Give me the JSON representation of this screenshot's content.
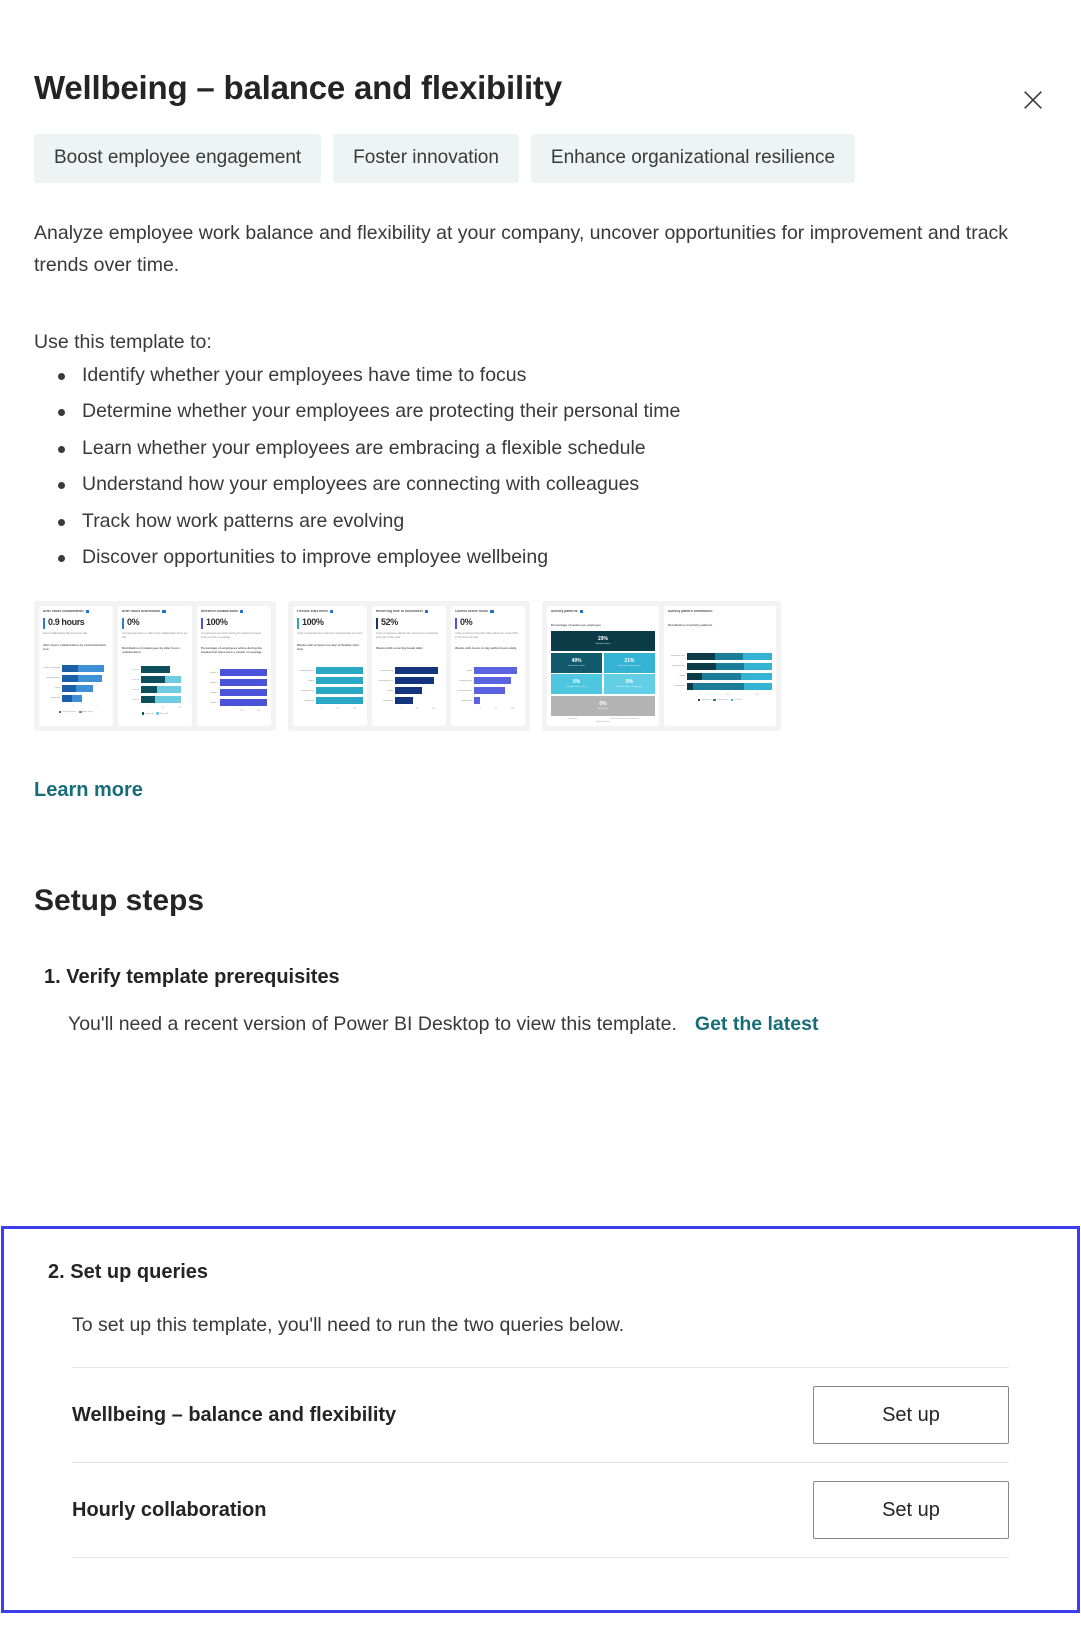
{
  "close_icon": "close-icon",
  "header": {
    "title": "Wellbeing – balance and flexibility",
    "chips": [
      "Boost employee engagement",
      "Foster innovation",
      "Enhance organizational resilience"
    ]
  },
  "intro": "Analyze employee work balance and flexibility at your company, uncover opportunities for improvement and track trends over time.",
  "uses_label": "Use this template to:",
  "uses": [
    "Identify whether your employees have time to focus",
    "Determine whether your employees are protecting their personal time",
    "Learn whether your employees are embracing a flexible schedule",
    "Understand how your employees are connecting with colleagues",
    "Track how work patterns are evolving",
    "Discover opportunities to improve employee wellbeing"
  ],
  "learn_more": "Learn more",
  "setup": {
    "heading": "Setup steps",
    "step1": {
      "heading": "1. Verify template prerequisites",
      "body": "You'll need a recent version of Power BI Desktop to view this template.",
      "link": "Get the latest"
    },
    "step2": {
      "heading": "2. Set up queries",
      "body": "To set up this template, you'll need to run the two queries below.",
      "queries": [
        {
          "name": "Wellbeing – balance and flexibility",
          "button": "Set up"
        },
        {
          "name": "Hourly collaboration",
          "button": "Set up"
        }
      ]
    }
  },
  "colors": {
    "accent_link": "#176e7a",
    "focus_border": "#3d3df0",
    "chip_bg": "#eef4f4",
    "blue": "#2b7cd3",
    "teal_dark": "#0d4e5c",
    "cyan": "#35b3d4",
    "indigo": "#4a53d8",
    "navy": "#1b3f8f",
    "gray": "#b3b3b3"
  },
  "chart_data": [
    {
      "type": "bar",
      "title": "After hours collaboration",
      "kpi": "0.9 hours",
      "kpi_sub": "spent collaborating after hours per day",
      "section": "After hours collaboration by communication tool",
      "categories": [
        "Instant Messages",
        "Email Hours",
        "Calls",
        "Meetings"
      ],
      "series": [
        {
          "name": "Working hours",
          "values": [
            35,
            33,
            30,
            22
          ]
        },
        {
          "name": "After hours",
          "values": [
            55,
            52,
            36,
            20
          ]
        }
      ],
      "colors": [
        "#1c5fa8",
        "#3d8fd6"
      ],
      "xlabel": "",
      "ylabel": ""
    },
    {
      "type": "bar",
      "title": "After hours distribution",
      "kpi": "0%",
      "kpi_sub": "of employees have 2+ after hours collaboration hours per day",
      "section": "Distribution of employees by after hours collaboration",
      "categories": [
        "0-1 hrs",
        "1-2 hrs",
        "2-3 hrs",
        "3+ hrs"
      ],
      "series": [
        {
          "name": "Group A",
          "values": [
            62,
            52,
            34,
            30
          ]
        },
        {
          "name": "Group B",
          "values": [
            0,
            34,
            52,
            56
          ]
        }
      ],
      "colors": [
        "#0d4e5c",
        "#6ecce2"
      ],
      "xlabel": "",
      "ylabel": ""
    },
    {
      "type": "bar",
      "title": "Weekend collaboration",
      "kpi": "100%",
      "kpi_sub": "of employees are active during the weekend at least once a month on average",
      "section": "Percentage of employees active during the weekend at least once a month on average",
      "categories": [
        "Week 1",
        "Week 2",
        "Week 3",
        "Week 4"
      ],
      "values": [
        100,
        100,
        100,
        100
      ],
      "colors": [
        "#4a53d8"
      ],
      "xlabel": "",
      "ylabel": ""
    },
    {
      "type": "bar",
      "title": "Flexible start times",
      "kpi": "100%",
      "kpi_sub": "of the employees have start time varied at least one hour",
      "section": "Weeks with at least one day of flexible start time",
      "categories": [
        "Business Dev",
        "Sales",
        "Engineering",
        "Marketing"
      ],
      "values": [
        100,
        100,
        100,
        100
      ],
      "colors": [
        "#2aa7c4"
      ],
      "xlabel": "",
      "ylabel": ""
    },
    {
      "type": "bar",
      "title": "Recurring time to disconnect",
      "kpi": "52%",
      "kpi_sub": "of the employees maintain the same hours of inactivity each day of the week",
      "section": "Weeks with recurring break daily",
      "categories": [
        "Engineering",
        "Business Dev",
        "Sales",
        "Marketing"
      ],
      "values": [
        92,
        84,
        58,
        38
      ],
      "colors": [
        "#12357e"
      ],
      "xlabel": "",
      "ylabel": ""
    },
    {
      "type": "bar",
      "title": "Control active hours",
      "kpi": "0%",
      "kpi_sub": "of the employees feel their daily activity are in the 9:00-17:00 hours per day",
      "section": "Weeks with hours in day within hours daily",
      "categories": [
        "Sales",
        "Engineering",
        "Business Dev",
        "Marketing"
      ],
      "values": [
        92,
        78,
        66,
        12
      ],
      "colors": [
        "#4a53d8"
      ],
      "xlabel": "",
      "ylabel": ""
    },
    {
      "type": "heatmap",
      "title": "Activity patterns",
      "section": "Percentage of weeks per employee",
      "cells": [
        {
          "value": "29%",
          "label": "Standard hours",
          "color": "#0b3b47",
          "span": 2
        },
        {
          "value": "49%",
          "label": "Later hours, focus",
          "color": "#12596c",
          "span": 1
        },
        {
          "value": "21%",
          "label": "Later hours, disconnect",
          "color": "#35b3d4",
          "span": 1
        },
        {
          "value": "0%",
          "label": "Flexible hours, focus",
          "color": "#4ec6e0",
          "span": 1
        },
        {
          "value": "0%",
          "label": "Flexible hours, disconnect",
          "color": "#63cfe6",
          "span": 1
        },
        {
          "value": "0%",
          "label": "No pattern",
          "color": "#b3b3b3",
          "span": 2
        }
      ],
      "axis": [
        "No breaks",
        "Recurring time to disconnect"
      ],
      "xlabel": "Flexibility level"
    },
    {
      "type": "bar",
      "title": "Activity pattern distribution",
      "section": "Distribution of activity patterns",
      "categories": [
        "Business Dev",
        "Engineering",
        "Sales",
        "Marketing"
      ],
      "series": [
        {
          "name": "Standard",
          "values": [
            33,
            34,
            18,
            7
          ]
        },
        {
          "name": "Later hours",
          "values": [
            33,
            33,
            46,
            60
          ]
        },
        {
          "name": "Flexible",
          "values": [
            34,
            33,
            36,
            33
          ]
        }
      ],
      "colors": [
        "#0b3b47",
        "#1b7d97",
        "#35b3d4"
      ],
      "xlabel": "",
      "ylabel": ""
    }
  ]
}
